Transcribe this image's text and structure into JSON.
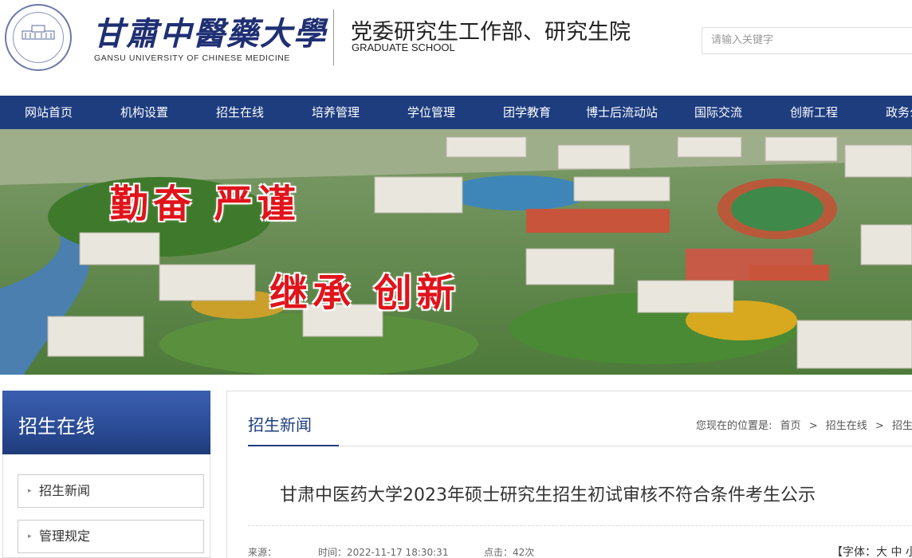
{
  "header": {
    "logo_cn": "甘肅中醫藥大學",
    "logo_en": "GANSU UNIVERSITY OF CHINESE MEDICINE",
    "dept_cn": "党委研究生工作部、研究生院",
    "dept_en": "GRADUATE SCHOOL",
    "search_placeholder": "请输入关键字"
  },
  "nav": {
    "items": [
      "网站首页",
      "机构设置",
      "招生在线",
      "培养管理",
      "学位管理",
      "团学教育",
      "博士后流动站",
      "国际交流",
      "创新工程",
      "政务公开"
    ]
  },
  "banner": {
    "slogan_1": "勤奋  严谨",
    "slogan_2": "继承  创新"
  },
  "sidebar": {
    "title": "招生在线",
    "items": [
      "招生新闻",
      "管理规定"
    ]
  },
  "main": {
    "tab": "招生新闻",
    "breadcrumb_prefix": "您现在的位置是:",
    "breadcrumb": [
      "首页",
      ">",
      "招生在线",
      ">",
      "招生新闻"
    ],
    "article_title": "甘肃中医药大学2023年硕士研究生招生初试审核不符合条件考生公示",
    "source_label": "来源：",
    "time": "时间：2022-11-17 18:30:31",
    "clicks": "点击：42次",
    "font_label": "【字体：大 中 小】"
  },
  "colors": {
    "nav_bg": "#1e3d7f",
    "sidebar_head": "#2c4d98",
    "slogan": "#e0141b",
    "accent": "#1e3d7f"
  }
}
